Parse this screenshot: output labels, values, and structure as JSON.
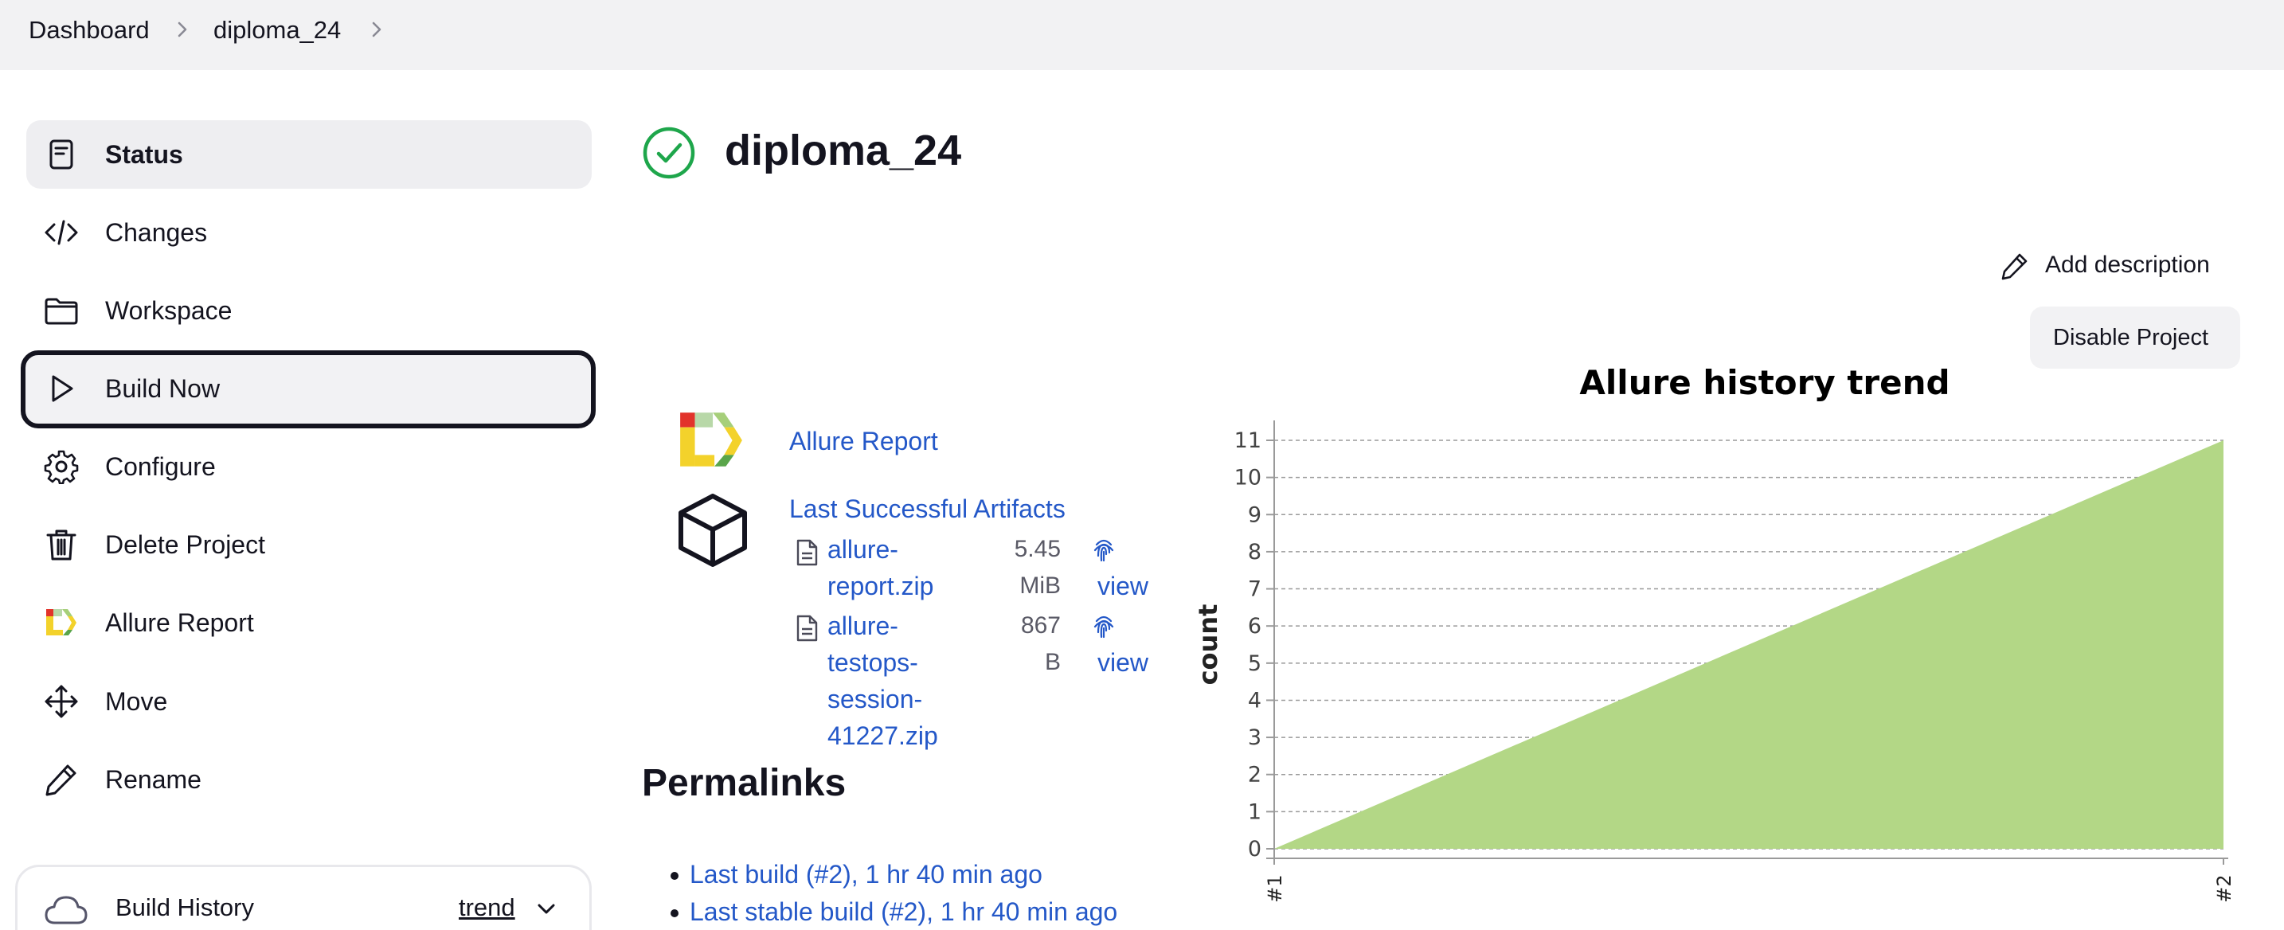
{
  "breadcrumb": [
    "Dashboard",
    "diploma_24"
  ],
  "sidebar": {
    "items": [
      {
        "label": "Status",
        "icon": "status-icon"
      },
      {
        "label": "Changes",
        "icon": "code-icon"
      },
      {
        "label": "Workspace",
        "icon": "folder-icon"
      },
      {
        "label": "Build Now",
        "icon": "play-icon"
      },
      {
        "label": "Configure",
        "icon": "gear-icon"
      },
      {
        "label": "Delete Project",
        "icon": "trash-icon"
      },
      {
        "label": "Allure Report",
        "icon": "allure-icon"
      },
      {
        "label": "Move",
        "icon": "move-icon"
      },
      {
        "label": "Rename",
        "icon": "pencil-icon"
      }
    ],
    "build_history": {
      "label": "Build History",
      "trend_link": "trend"
    }
  },
  "main": {
    "title": "diploma_24",
    "add_description": "Add description",
    "disable_project": "Disable Project",
    "allure_report_link": "Allure Report",
    "artifacts": {
      "title": "Last Successful Artifacts",
      "files": [
        {
          "name_lines": [
            "allure-",
            "report.zip"
          ],
          "size_lines": [
            "5.45",
            "MiB"
          ],
          "view": "view"
        },
        {
          "name_lines": [
            "allure-",
            "testops-",
            "session-",
            "41227.zip"
          ],
          "size_lines": [
            "867",
            "B"
          ],
          "view": "view"
        }
      ]
    },
    "permalinks": {
      "title": "Permalinks",
      "items": [
        "Last build (#2), 1 hr 40 min ago",
        "Last stable build (#2), 1 hr 40 min ago"
      ]
    }
  },
  "colors": {
    "accent_link": "#2458c8",
    "success": "#1ea64b",
    "chart_fill": "#b3d786"
  },
  "chart_data": {
    "type": "area",
    "title": "Allure history trend",
    "ylabel": "count",
    "xlabel": "",
    "x": [
      "#1",
      "#2"
    ],
    "series": [
      {
        "values": [
          0,
          11
        ]
      }
    ],
    "ylim": [
      0,
      11
    ],
    "yticks": [
      0,
      1,
      2,
      3,
      4,
      5,
      6,
      7,
      8,
      9,
      10,
      11
    ],
    "grid": true
  }
}
